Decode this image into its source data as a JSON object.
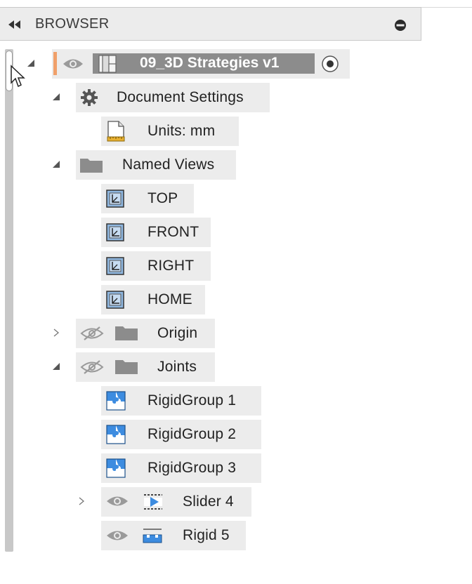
{
  "panel": {
    "title": "BROWSER",
    "collapse_icon": "double-left-arrow-icon",
    "menu_icon": "minus-circle-icon"
  },
  "root": {
    "label": "09_3D Strategies v1",
    "accent_color": "#f0a06a",
    "icons": [
      "eye-icon",
      "component-icon",
      "radio-target-icon"
    ]
  },
  "tree": [
    {
      "label": "Document Settings",
      "icon": "gear-icon"
    },
    {
      "label": "Units: mm",
      "icon": "units-document-icon"
    },
    {
      "label": "Named Views",
      "icon": "folder-icon"
    },
    {
      "label": "TOP",
      "icon": "named-view-icon"
    },
    {
      "label": "FRONT",
      "icon": "named-view-icon"
    },
    {
      "label": "RIGHT",
      "icon": "named-view-icon"
    },
    {
      "label": "HOME",
      "icon": "named-view-icon"
    },
    {
      "label": "Origin",
      "icon": "folder-icon",
      "visibility": "eye-hidden-icon"
    },
    {
      "label": "Joints",
      "icon": "folder-icon",
      "visibility": "eye-hidden-icon"
    },
    {
      "label": "RigidGroup 1",
      "icon": "rigid-group-icon"
    },
    {
      "label": "RigidGroup 2",
      "icon": "rigid-group-icon"
    },
    {
      "label": "RigidGroup 3",
      "icon": "rigid-group-icon"
    },
    {
      "label": "Slider 4",
      "icon": "slider-joint-icon",
      "visibility": "eye-icon"
    },
    {
      "label": "Rigid 5",
      "icon": "rigid-joint-icon",
      "visibility": "eye-icon"
    }
  ]
}
